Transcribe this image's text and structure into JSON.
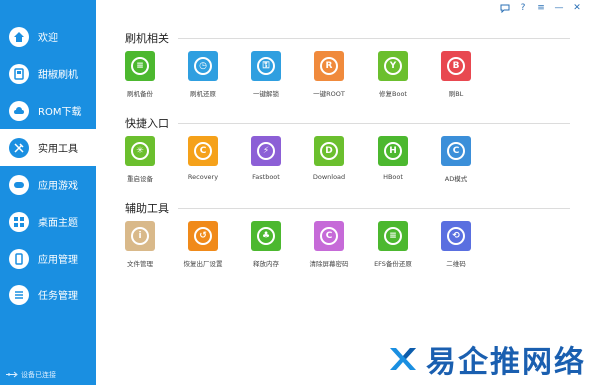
{
  "sidebar": {
    "items": [
      {
        "label": "欢迎",
        "icon": "home-icon",
        "active": false
      },
      {
        "label": "甜椒刷机",
        "icon": "flash-icon",
        "active": false
      },
      {
        "label": "ROM下载",
        "icon": "cloud-icon",
        "active": false
      },
      {
        "label": "实用工具",
        "icon": "tools-icon",
        "active": true
      },
      {
        "label": "应用游戏",
        "icon": "gamepad-icon",
        "active": false
      },
      {
        "label": "桌面主题",
        "icon": "grid-icon",
        "active": false
      },
      {
        "label": "应用管理",
        "icon": "phone-icon",
        "active": false
      },
      {
        "label": "任务管理",
        "icon": "list-icon",
        "active": false
      }
    ],
    "status": "设备已连接"
  },
  "window": {
    "controls": [
      "chat-icon",
      "help-icon",
      "menu-icon",
      "minimize-icon",
      "close-icon"
    ],
    "help_label": "?",
    "close_label": "✕",
    "minimize_label": "—",
    "menu_label": "≡"
  },
  "sections": [
    {
      "title": "刷机相关",
      "tools": [
        {
          "label": "刷机备份",
          "color": "#4cb82f",
          "glyph": "≡"
        },
        {
          "label": "刷机还原",
          "color": "#2f9fe0",
          "glyph": "◷"
        },
        {
          "label": "一键解锁",
          "color": "#2f9fe0",
          "glyph": "⚿"
        },
        {
          "label": "一键ROOT",
          "color": "#f08a3c",
          "glyph": "R"
        },
        {
          "label": "修复Boot",
          "color": "#6bbf2e",
          "glyph": "Y"
        },
        {
          "label": "刷BL",
          "color": "#e84850",
          "glyph": "B"
        }
      ]
    },
    {
      "title": "快捷入口",
      "tools": [
        {
          "label": "重启设备",
          "color": "#6bbf2e",
          "glyph": "✳"
        },
        {
          "label": "Recovery",
          "color": "#f5a11a",
          "glyph": "C"
        },
        {
          "label": "Fastboot",
          "color": "#8c5fd6",
          "glyph": "⚡"
        },
        {
          "label": "Download",
          "color": "#6bbf2e",
          "glyph": "D"
        },
        {
          "label": "HBoot",
          "color": "#4cb82f",
          "glyph": "H"
        },
        {
          "label": "AD模式",
          "color": "#3b8fd9",
          "glyph": "C"
        }
      ]
    },
    {
      "title": "辅助工具",
      "tools": [
        {
          "label": "文件管理",
          "color": "#d9b98a",
          "glyph": "i"
        },
        {
          "label": "恢复出厂设置",
          "color": "#f08a1a",
          "glyph": "↺"
        },
        {
          "label": "释放内存",
          "color": "#4cb82f",
          "glyph": "♣"
        },
        {
          "label": "清除屏幕密码",
          "color": "#c66ad8",
          "glyph": "C"
        },
        {
          "label": "EFS备份还原",
          "color": "#4cb82f",
          "glyph": "≡"
        },
        {
          "label": "二维码",
          "color": "#5a6fe0",
          "glyph": "⟲"
        }
      ]
    }
  ],
  "watermark": {
    "text": "易企推网络"
  }
}
